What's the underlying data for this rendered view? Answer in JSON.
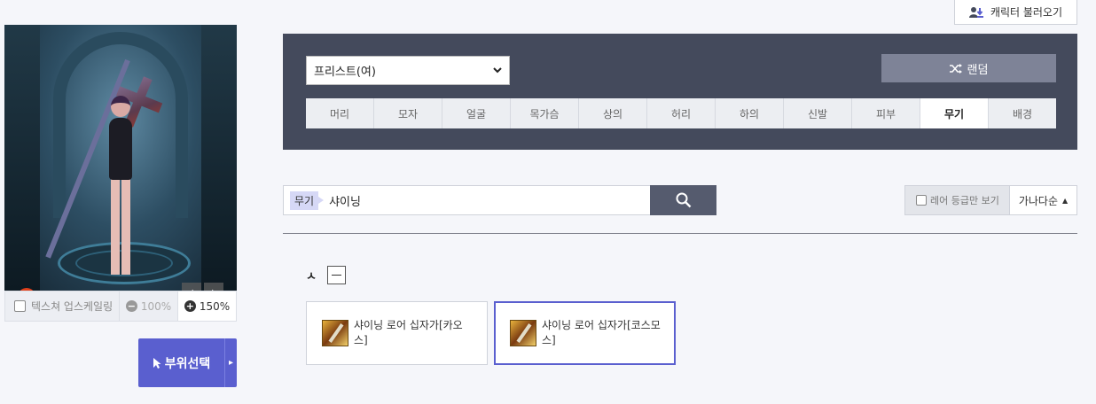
{
  "header": {
    "load_character_label": "캐릭터 불러오기",
    "load_icon": "user-download-icon"
  },
  "preview": {
    "alert_icon_glyph": "!",
    "prev_glyph": "‹",
    "next_glyph": "›"
  },
  "view_options": {
    "texture_upscale_label": "텍스쳐 업스케일링",
    "texture_upscale_checked": false,
    "zoom_out_label": "100%",
    "zoom_in_label": "150%",
    "active_zoom": "150%"
  },
  "part_select": {
    "label": "부위선택",
    "side_glyph": "▸"
  },
  "panel": {
    "job_select_value": "프리스트(여)",
    "random_label": "랜덤",
    "tabs": [
      {
        "label": "머리"
      },
      {
        "label": "모자"
      },
      {
        "label": "얼굴"
      },
      {
        "label": "목가슴"
      },
      {
        "label": "상의"
      },
      {
        "label": "허리"
      },
      {
        "label": "하의"
      },
      {
        "label": "신발"
      },
      {
        "label": "피부"
      },
      {
        "label": "무기",
        "active": true
      },
      {
        "label": "배경"
      }
    ]
  },
  "search": {
    "tag": "무기",
    "query": "샤이닝"
  },
  "filters": {
    "rare_only_label": "레어 등급만 보기",
    "rare_only_checked": false,
    "sort_label": "가나다순",
    "sort_glyph": "▲"
  },
  "results": {
    "group_label": "ㅅ",
    "items": [
      {
        "name": "샤이닝 로어 십자가[카오스]",
        "selected": false
      },
      {
        "name": "샤이닝 로어 십자가[코스모스]",
        "selected": true
      }
    ]
  },
  "colors": {
    "accent": "#5a5fcf",
    "panel_bg": "#444a5c",
    "search_button_bg": "#555b6e",
    "random_button_bg": "#7e8397"
  }
}
